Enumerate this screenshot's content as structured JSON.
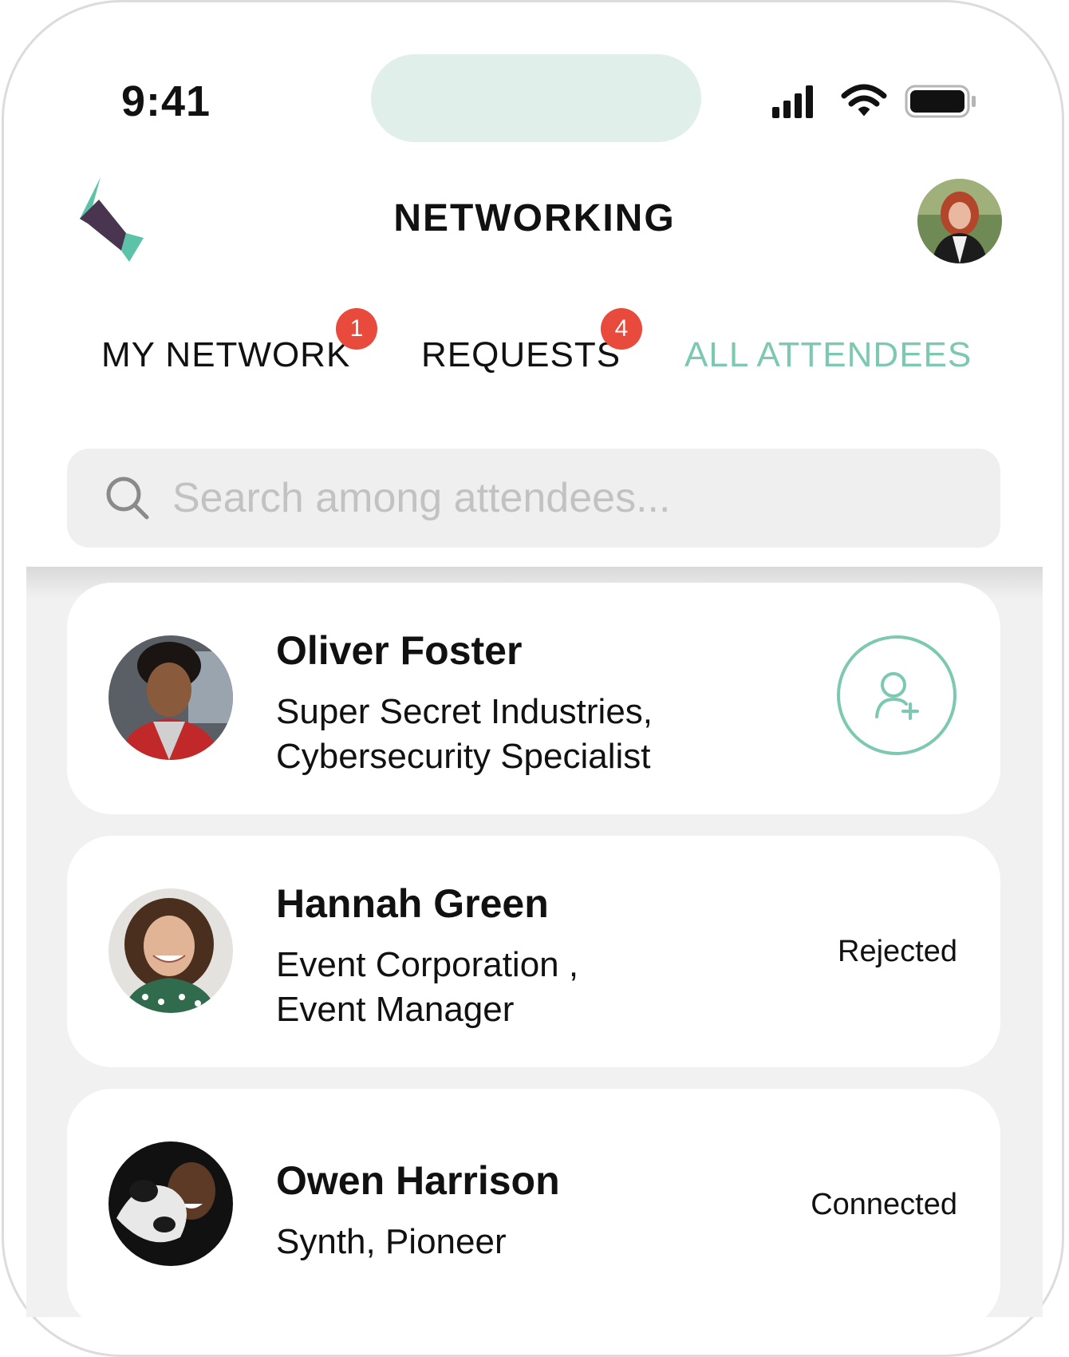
{
  "status_bar": {
    "time": "9:41",
    "icons": [
      "signal-icon",
      "wifi-icon",
      "battery-icon"
    ]
  },
  "header": {
    "title": "NETWORKING"
  },
  "tabs": [
    {
      "label": "MY NETWORK",
      "badge": "1",
      "active": false
    },
    {
      "label": "REQUESTS",
      "badge": "4",
      "active": false
    },
    {
      "label": "ALL ATTENDEES",
      "badge": null,
      "active": true
    }
  ],
  "search": {
    "placeholder": "Search among attendees..."
  },
  "attendees": [
    {
      "name": "Oliver Foster",
      "subtitle_line1": "Super Secret Industries,",
      "subtitle_line2": "Cybersecurity Specialist",
      "action": "add-connection-button",
      "status": null
    },
    {
      "name": "Hannah Green",
      "subtitle_line1": "Event Corporation ,",
      "subtitle_line2": "Event Manager",
      "action": null,
      "status": "Rejected"
    },
    {
      "name": "Owen Harrison",
      "subtitle_line1": "Synth, Pioneer",
      "subtitle_line2": "",
      "action": null,
      "status": "Connected"
    }
  ],
  "colors": {
    "accent": "#7cc8b1",
    "badge": "#e84a3c",
    "island": "#e0efea",
    "list_background": "#f1f1f1",
    "logo_dark": "#4a3550",
    "logo_teal": "#5cc3a8"
  }
}
